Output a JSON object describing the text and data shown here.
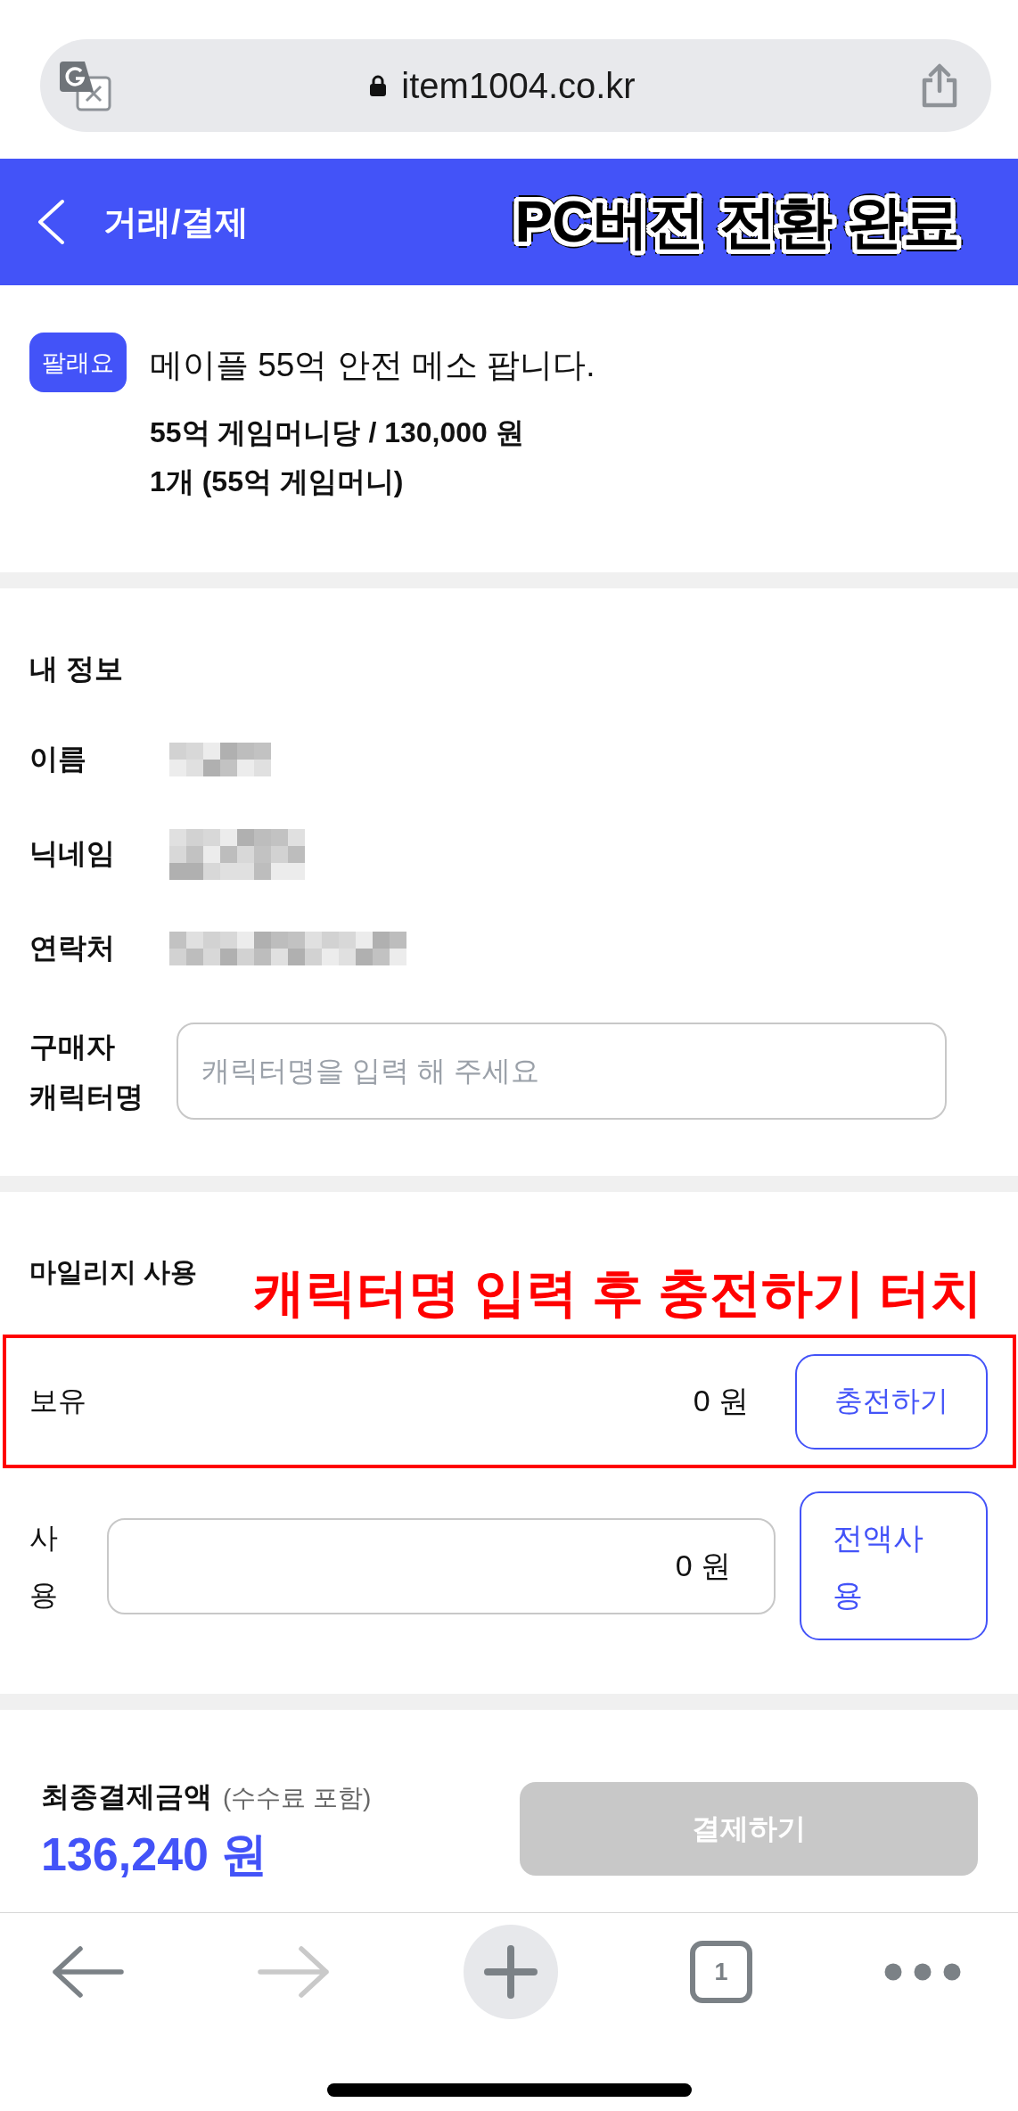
{
  "browser": {
    "url": "item1004.co.kr"
  },
  "header": {
    "title": "거래/결제",
    "overlay_caption": "PC버전 전환 완료"
  },
  "product": {
    "badge": "팔래요",
    "title": "메이플 55억 안전 메소 팝니다.",
    "details": [
      "55억 게임머니당 / 130,000 원",
      "1개 (55억 게임머니)"
    ]
  },
  "my_info": {
    "heading": "내 정보",
    "rows": [
      {
        "label": "이름",
        "kind": "redacted"
      },
      {
        "label": "닉네임",
        "kind": "redacted"
      },
      {
        "label": "연락처",
        "kind": "redacted"
      },
      {
        "label": "구매자 캐릭터명",
        "kind": "input",
        "placeholder": "캐릭터명을 입력 해 주세요"
      }
    ]
  },
  "mileage": {
    "heading": "마일리지 사용",
    "annotation": "캐릭터명 입력 후 충전하기 터치",
    "balance": {
      "label": "보유",
      "value": "0 원",
      "button": "충전하기",
      "highlighted": true
    },
    "use": {
      "label": "사용",
      "value": "0 원",
      "button": "전액사용"
    }
  },
  "payment": {
    "label": "최종결제금액",
    "note": "(수수료 포함)",
    "amount": "136,240 원",
    "button": {
      "label": "결제하기",
      "disabled": true
    }
  },
  "toolbar": [
    {
      "kind": "back",
      "disabled": false
    },
    {
      "kind": "forward",
      "disabled": true
    },
    {
      "kind": "new_tab",
      "disabled": false
    },
    {
      "kind": "tabs",
      "label": "1",
      "disabled": false
    },
    {
      "kind": "more",
      "disabled": false
    }
  ]
}
